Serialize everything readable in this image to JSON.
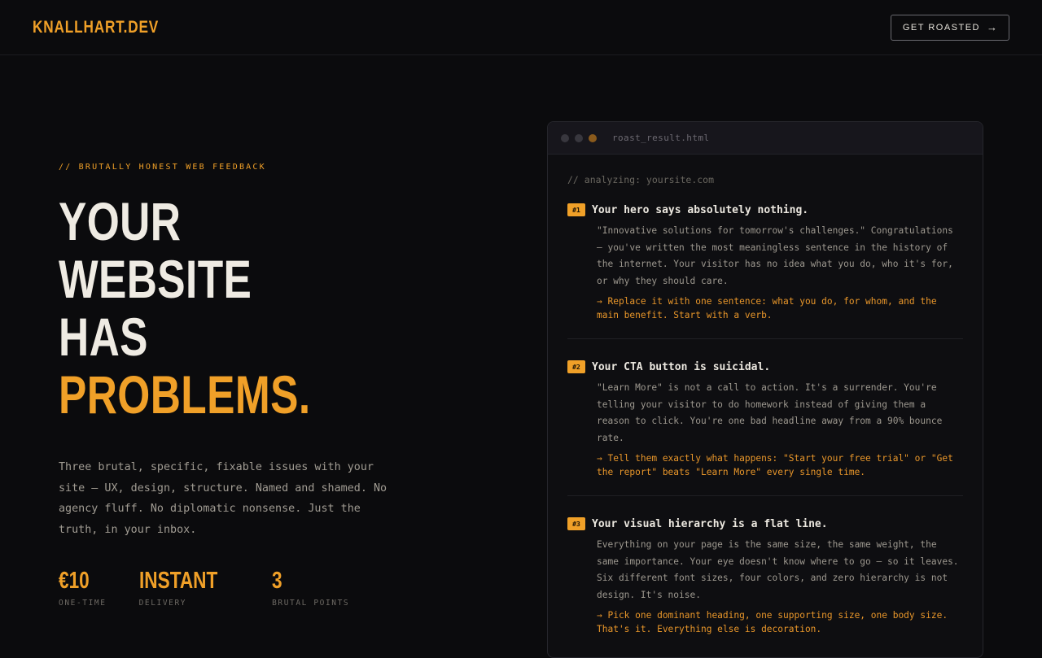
{
  "nav": {
    "logo": "KNALLHART.DEV",
    "cta_label": "GET ROASTED",
    "cta_arrow": "→"
  },
  "hero": {
    "eyebrow": "// BRUTALLY HONEST WEB FEEDBACK",
    "headline": [
      "YOUR",
      "WEBSITE",
      "HAS"
    ],
    "headline_accent": "PROBLEMS.",
    "lead": "Three brutal, specific, fixable issues with your site — UX, design, structure. Named and shamed. No agency fluff. No diplomatic nonsense. Just the truth, in your inbox.",
    "stats": [
      {
        "value": "€10",
        "label": "ONE-TIME"
      },
      {
        "value": "INSTANT",
        "label": "DELIVERY"
      },
      {
        "value": "3",
        "label": "BRUTAL POINTS"
      }
    ]
  },
  "window": {
    "title": "roast_result.html",
    "analyzing": "// analyzing: yoursite.com",
    "issues": [
      {
        "badge": "#1",
        "title": "Your hero says absolutely nothing.",
        "text": "\"Innovative solutions for tomorrow's challenges.\" Congratulations — you've written the most meaningless sentence in the history of the internet. Your visitor has no idea what you do, who it's for, or why they should care.",
        "fix": "→ Replace it with one sentence: what you do, for whom, and the main benefit. Start with a verb."
      },
      {
        "badge": "#2",
        "title": "Your CTA button is suicidal.",
        "text": "\"Learn More\" is not a call to action. It's a surrender. You're telling your visitor to do homework instead of giving them a reason to click. You're one bad headline away from a 90% bounce rate.",
        "fix": "→ Tell them exactly what happens: \"Start your free trial\" or \"Get the report\" beats \"Learn More\" every single time."
      },
      {
        "badge": "#3",
        "title": "Your visual hierarchy is a flat line.",
        "text": "Everything on your page is the same size, the same weight, the same importance. Your eye doesn't know where to go — so it leaves. Six different font sizes, four colors, and zero hierarchy is not design. It's noise.",
        "fix": "→ Pick one dominant heading, one supporting size, one body size. That's it. Everything else is decoration."
      }
    ]
  },
  "colors": {
    "accent": "#f0a028",
    "background": "#0b0b0d",
    "text": "#efebe3"
  }
}
